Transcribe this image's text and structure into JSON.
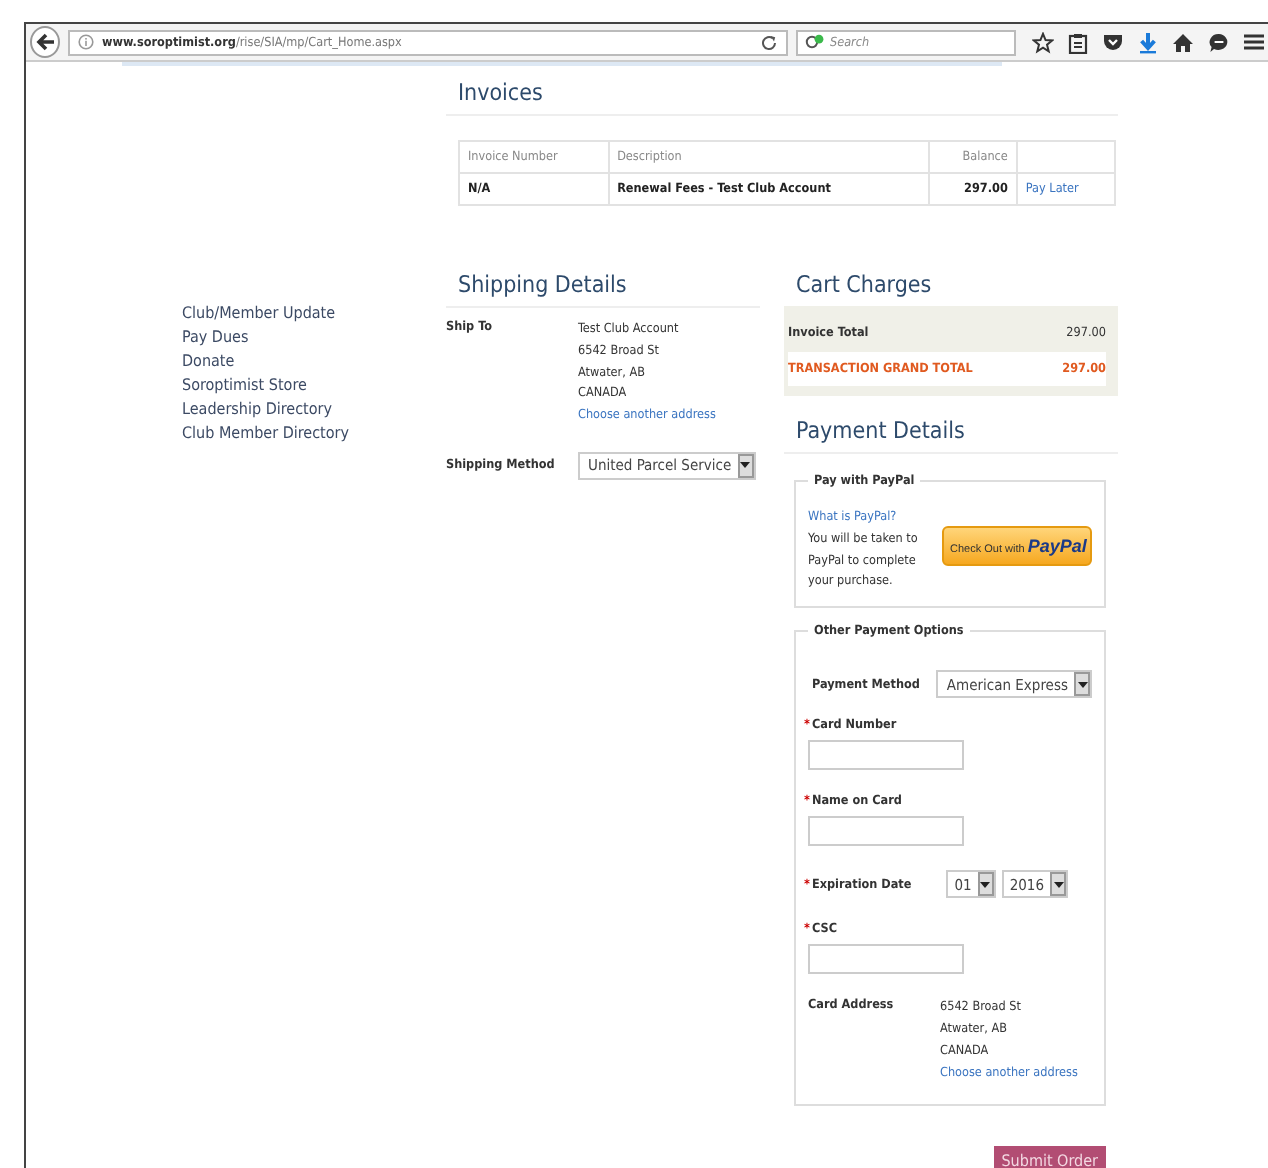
{
  "browser": {
    "url_domain": "www.soroptimist.org",
    "url_path": "/rise/SIA/mp/Cart_Home.aspx",
    "search_placeholder": "Search"
  },
  "sidebar": {
    "items": [
      "Club/Member Update",
      "Pay Dues",
      "Donate",
      "Soroptimist Store",
      "Leadership Directory",
      "Club Member Directory"
    ]
  },
  "invoices": {
    "title": "Invoices",
    "columns": [
      "Invoice Number",
      "Description",
      "Balance"
    ],
    "rows": [
      {
        "invoice_number": "N/A",
        "description": "Renewal Fees - Test Club Account",
        "balance": "297.00",
        "action": "Pay Later"
      }
    ]
  },
  "shipping": {
    "title": "Shipping Details",
    "ship_to_label": "Ship To",
    "address": [
      "Test Club Account",
      "6542 Broad St",
      "Atwater, AB",
      "CANADA"
    ],
    "address_link": "Choose another address",
    "method_label": "Shipping Method",
    "method": "United Parcel Service"
  },
  "cart_charges": {
    "title": "Cart Charges",
    "rows": [
      {
        "kind": "total",
        "label": "Invoice Total",
        "value": "297.00"
      },
      {
        "kind": "grand",
        "label": "TRANSACTION GRAND TOTAL",
        "value": "297.00"
      }
    ]
  },
  "payment": {
    "title": "Payment Details",
    "paypal": {
      "legend": "Pay with PayPal",
      "link": "What is PayPal?",
      "text": "You will be taken to PayPal to complete your purchase.",
      "button_text": "Check Out with",
      "button_brand": "PayPal"
    },
    "other": {
      "legend": "Other Payment Options",
      "method_label": "Payment Method",
      "method": "American Express",
      "fields": [
        {
          "kind": "text",
          "label": "Card Number",
          "required_mark": "*"
        },
        {
          "kind": "text",
          "label": "Name on Card",
          "required_mark": "*"
        },
        {
          "kind": "date",
          "label": "Expiration Date",
          "required_mark": "*",
          "month": "01",
          "year": "2016"
        },
        {
          "kind": "text",
          "label": "CSC",
          "required_mark": "*"
        }
      ],
      "card_address_label": "Card Address",
      "card_address": [
        "6542 Broad St",
        "Atwater, AB",
        "CANADA"
      ],
      "card_address_link": "Choose another address"
    }
  },
  "submit": "Submit Order"
}
